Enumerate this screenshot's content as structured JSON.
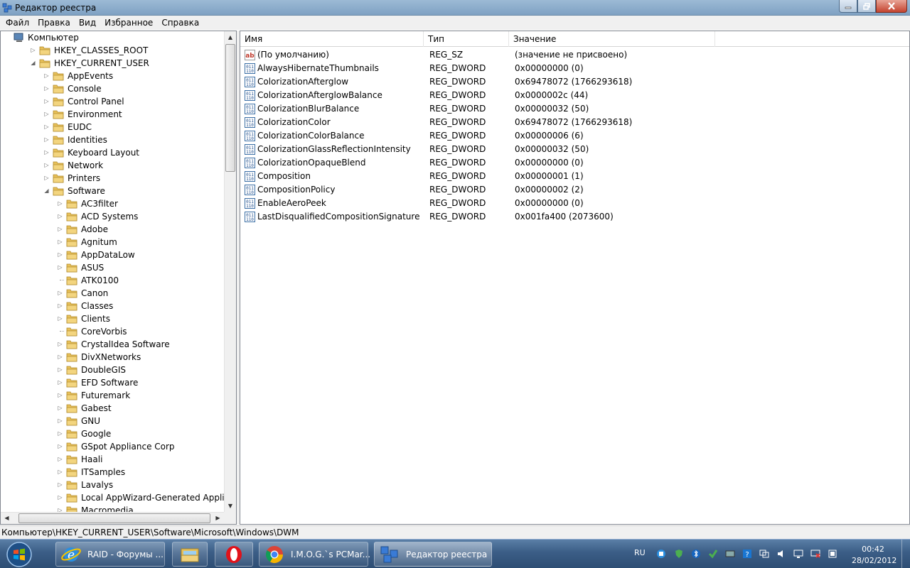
{
  "window": {
    "title": "Редактор реестра",
    "minimize_icon": "minimize-icon",
    "maximize_icon": "restore-icon",
    "close_icon": "close-icon"
  },
  "menu": [
    "Файл",
    "Правка",
    "Вид",
    "Избранное",
    "Справка"
  ],
  "tree": {
    "root": "Компьютер",
    "hkcr": "HKEY_CLASSES_ROOT",
    "hkcu": "HKEY_CURRENT_USER",
    "hkcu_children": [
      "AppEvents",
      "Console",
      "Control Panel",
      "Environment",
      "EUDC",
      "Identities",
      "Keyboard Layout",
      "Network",
      "Printers",
      "Software"
    ],
    "software_children": [
      "AC3filter",
      "ACD Systems",
      "Adobe",
      "Agnitum",
      "AppDataLow",
      "ASUS",
      "ATK0100",
      "Canon",
      "Classes",
      "Clients",
      "CoreVorbis",
      "CrystalIdea Software",
      "DivXNetworks",
      "DoubleGIS",
      "EFD Software",
      "Futuremark",
      "Gabest",
      "GNU",
      "Google",
      "GSpot Appliance Corp",
      "Haali",
      "ITSamples",
      "Lavalys",
      "Local AppWizard-Generated Applications",
      "Macromedia"
    ]
  },
  "list": {
    "columns": [
      "Имя",
      "Тип",
      "Значение"
    ],
    "rows": [
      {
        "name": "(По умолчанию)",
        "type": "REG_SZ",
        "value": "(значение не присвоено)",
        "icon": "string-value-icon"
      },
      {
        "name": "AlwaysHibernateThumbnails",
        "type": "REG_DWORD",
        "value": "0x00000000 (0)",
        "icon": "binary-value-icon"
      },
      {
        "name": "ColorizationAfterglow",
        "type": "REG_DWORD",
        "value": "0x69478072 (1766293618)",
        "icon": "binary-value-icon"
      },
      {
        "name": "ColorizationAfterglowBalance",
        "type": "REG_DWORD",
        "value": "0x0000002c (44)",
        "icon": "binary-value-icon"
      },
      {
        "name": "ColorizationBlurBalance",
        "type": "REG_DWORD",
        "value": "0x00000032 (50)",
        "icon": "binary-value-icon"
      },
      {
        "name": "ColorizationColor",
        "type": "REG_DWORD",
        "value": "0x69478072 (1766293618)",
        "icon": "binary-value-icon"
      },
      {
        "name": "ColorizationColorBalance",
        "type": "REG_DWORD",
        "value": "0x00000006 (6)",
        "icon": "binary-value-icon"
      },
      {
        "name": "ColorizationGlassReflectionIntensity",
        "type": "REG_DWORD",
        "value": "0x00000032 (50)",
        "icon": "binary-value-icon"
      },
      {
        "name": "ColorizationOpaqueBlend",
        "type": "REG_DWORD",
        "value": "0x00000000 (0)",
        "icon": "binary-value-icon"
      },
      {
        "name": "Composition",
        "type": "REG_DWORD",
        "value": "0x00000001 (1)",
        "icon": "binary-value-icon"
      },
      {
        "name": "CompositionPolicy",
        "type": "REG_DWORD",
        "value": "0x00000002 (2)",
        "icon": "binary-value-icon"
      },
      {
        "name": "EnableAeroPeek",
        "type": "REG_DWORD",
        "value": "0x00000000 (0)",
        "icon": "binary-value-icon"
      },
      {
        "name": "LastDisqualifiedCompositionSignature",
        "type": "REG_DWORD",
        "value": "0x001fa400 (2073600)",
        "icon": "binary-value-icon"
      }
    ]
  },
  "status": {
    "path": "Компьютер\\HKEY_CURRENT_USER\\Software\\Microsoft\\Windows\\DWM"
  },
  "taskbar": {
    "buttons": [
      {
        "label": "RAID - Форумы ...",
        "icon": "internet-explorer-icon"
      },
      {
        "label": "",
        "icon": "windows-explorer-icon"
      },
      {
        "label": "",
        "icon": "opera-icon"
      },
      {
        "label": "I.M.O.G.`s PCMar...",
        "icon": "chrome-icon"
      },
      {
        "label": "Редактор реестра",
        "icon": "regedit-icon"
      }
    ],
    "language": "RU",
    "time": "00:42",
    "date": "28/02/2012"
  },
  "colors": {
    "taskbar": "#3b5d86",
    "folder": "#e8c15a"
  }
}
